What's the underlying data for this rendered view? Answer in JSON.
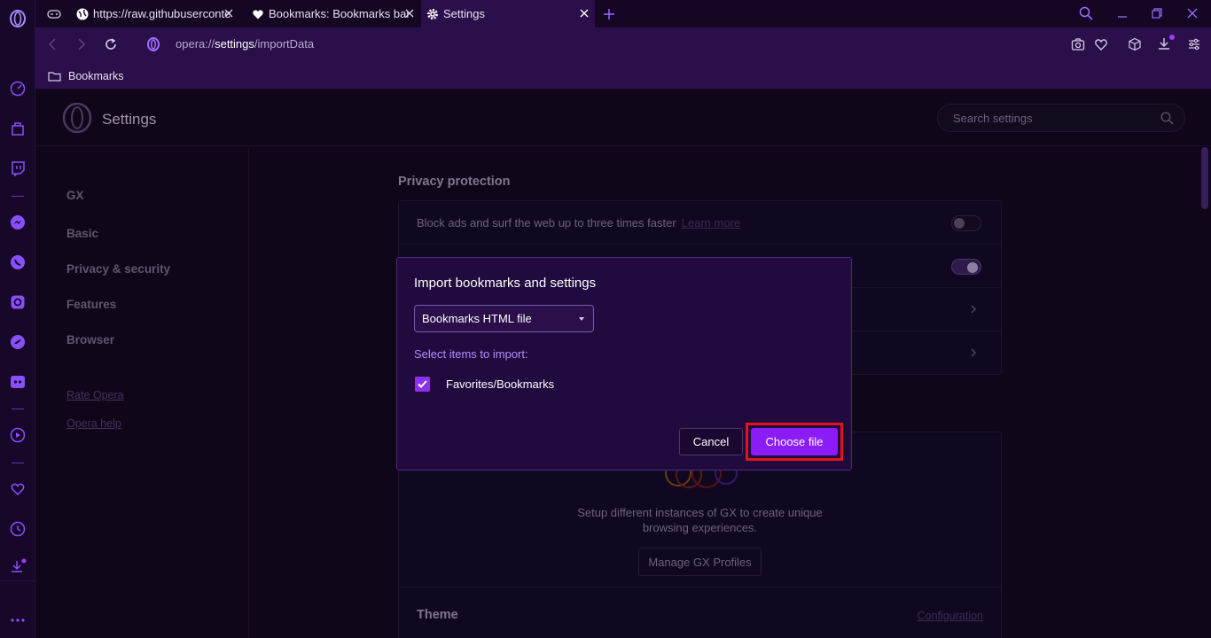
{
  "tabs": [
    {
      "title": "https://raw.githubuserconte",
      "icon": "globe-icon"
    },
    {
      "title": "Bookmarks: Bookmarks bar",
      "icon": "heart-icon"
    },
    {
      "title": "Settings",
      "icon": "gear-icon",
      "active": true
    }
  ],
  "address": {
    "prefix": "opera://",
    "host": "settings",
    "path": "/importData"
  },
  "bookmarks_bar": {
    "item": "Bookmarks"
  },
  "settings": {
    "title": "Settings",
    "search_placeholder": "Search settings",
    "nav": [
      "GX",
      "Basic",
      "Privacy & security",
      "Features",
      "Browser"
    ],
    "links": [
      "Rate Opera",
      "Opera help"
    ],
    "privacy_section": "Privacy protection",
    "block_ads_text": "Block ads and surf the web up to three times faster",
    "learn_more": "Learn more",
    "gx_profiles_desc_1": "Setup different instances of GX to create unique",
    "gx_profiles_desc_2": "browsing experiences.",
    "gx_profiles_button": "Manage GX Profiles",
    "theme_title": "Theme",
    "configuration_link": "Configuration"
  },
  "dialog": {
    "title": "Import bookmarks and settings",
    "source_value": "Bookmarks HTML file",
    "select_items_label": "Select items to import:",
    "checkbox_label": "Favorites/Bookmarks",
    "checkbox_checked": true,
    "cancel_label": "Cancel",
    "choose_label": "Choose file"
  },
  "colors": {
    "accent": "#8b1cf5",
    "highlight_border": "#e0141e",
    "frame": "#2a0f4a"
  }
}
